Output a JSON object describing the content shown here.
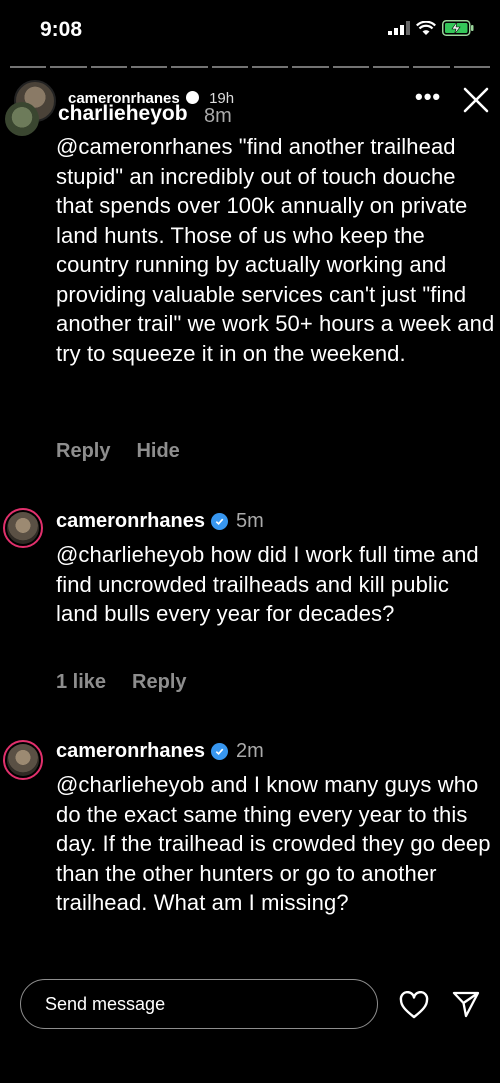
{
  "status_bar": {
    "time": "9:08"
  },
  "story": {
    "username": "cameronrhanes",
    "time": "19h",
    "more_label": "•••"
  },
  "reply_to": {
    "username": "charlieheyob",
    "time": "8m"
  },
  "comments": [
    {
      "text": "@cameronrhanes \"find another trailhead stupid\" an incredibly out of touch douche that spends over 100k annually on private land hunts. Those of us who keep the country running by actually working and providing valuable services can't just \"find another trail\" we work 50+ hours a week and try to squeeze it in on the weekend.",
      "actions": [
        "Reply",
        "Hide"
      ]
    },
    {
      "username": "cameronrhanes",
      "time": "5m",
      "text": "@charlieheyob how did I work full time and find uncrowded trailheads and kill public land bulls every year for decades?",
      "likes": "1 like",
      "reply": "Reply"
    },
    {
      "username": "cameronrhanes",
      "time": "2m",
      "text": "@charlieheyob and I know many guys who do the exact same thing every year to this day. If the trailhead is crowded they go deep than the other hunters or go to another trailhead. What am I missing?"
    }
  ],
  "composer": {
    "placeholder": "Send message"
  },
  "colors": {
    "accent_verified": "#3897f0",
    "muted": "#8e8e8e",
    "background": "#000000"
  }
}
